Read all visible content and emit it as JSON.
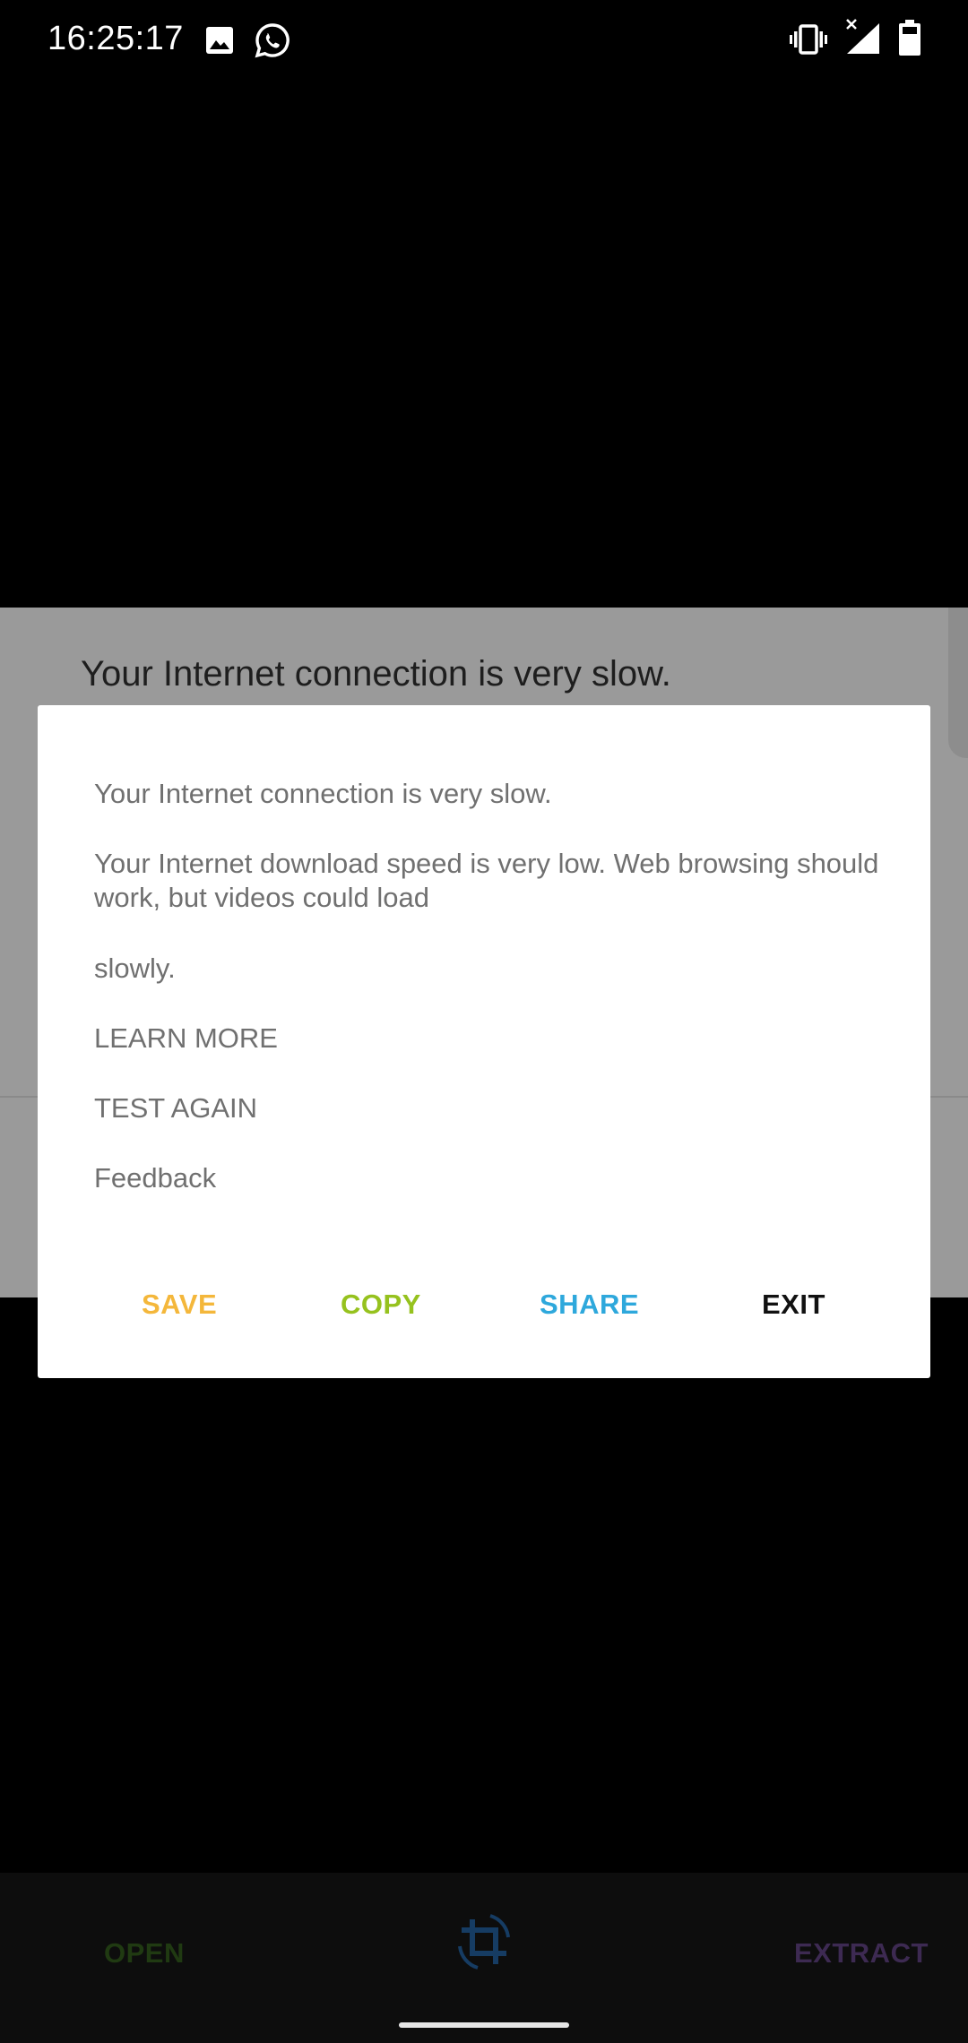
{
  "status_bar": {
    "time": "16:25:17",
    "left_icons": [
      "gallery-icon",
      "whatsapp-icon"
    ],
    "right_icons": [
      "vibrate-icon",
      "no-signal-icon",
      "battery-icon"
    ]
  },
  "background": {
    "title": "Your Internet connection is very slow."
  },
  "dialog": {
    "lines": [
      "Your Internet connection is very slow.",
      "Your Internet download speed is very low. Web browsing should work, but videos could load",
      "slowly.",
      "LEARN MORE",
      "TEST AGAIN",
      "Feedback"
    ],
    "actions": {
      "save": "SAVE",
      "copy": "COPY",
      "share": "SHARE",
      "exit": "EXIT"
    }
  },
  "bottom_bar": {
    "open": "OPEN",
    "extract": "EXTRACT",
    "center_icon": "crop-rotate-icon"
  },
  "colors": {
    "save": "#F4B73B",
    "copy": "#96C21E",
    "share": "#2EA8DC",
    "exit": "#111111",
    "open": "#203A12",
    "extract": "#3D2A52",
    "crop_icon": "#163C63"
  }
}
